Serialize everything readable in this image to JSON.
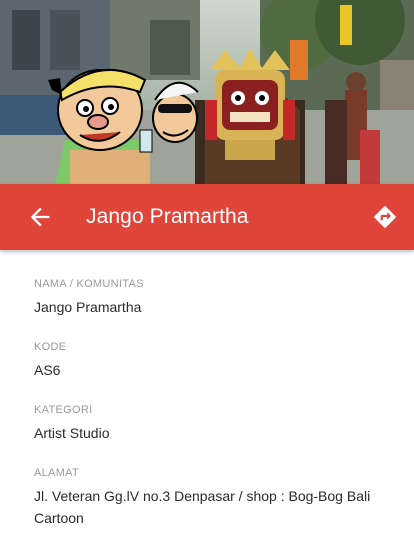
{
  "app_bar": {
    "title": "Jango Pramartha",
    "back_icon": "arrow-left-icon",
    "directions_icon": "directions-icon",
    "color": "#e0453a"
  },
  "hero": {
    "description_icon": "header-photo"
  },
  "fields": [
    {
      "label": "NAMA / KOMUNITAS",
      "value": "Jango Pramartha"
    },
    {
      "label": "KODE",
      "value": "AS6"
    },
    {
      "label": "KATEGORI",
      "value": "Artist Studio"
    },
    {
      "label": "ALAMAT",
      "value": "Jl. Veteran Gg.lV no.3 Denpasar / shop : Bog-Bog Bali Cartoon"
    }
  ]
}
